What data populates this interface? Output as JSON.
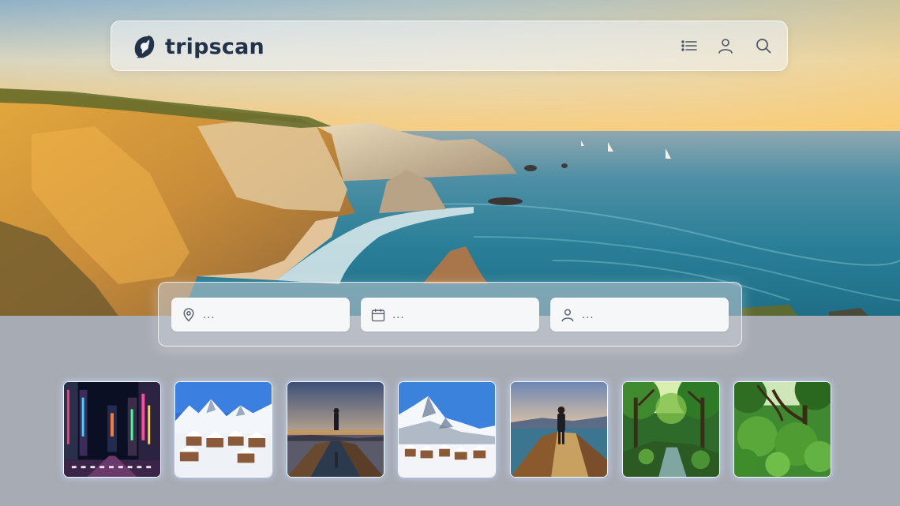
{
  "brand": {
    "name": "tripscan"
  },
  "nav": {
    "icons": [
      "list-icon",
      "user-icon",
      "search-icon"
    ]
  },
  "search": {
    "fields": [
      {
        "icon": "location-pin-icon",
        "value": "..."
      },
      {
        "icon": "calendar-icon",
        "value": "..."
      },
      {
        "icon": "person-icon",
        "value": "..."
      }
    ]
  },
  "destinations": [
    {
      "scene": "neon-city-street"
    },
    {
      "scene": "snowy-mountain-village"
    },
    {
      "scene": "sunset-lake-silhouette"
    },
    {
      "scene": "alpine-snow-village"
    },
    {
      "scene": "cliff-edge-traveler"
    },
    {
      "scene": "jungle-stream"
    },
    {
      "scene": "tropical-rainforest"
    }
  ],
  "colors": {
    "brand_text": "#22324a",
    "panel_bg": "#a7abb3",
    "field_bg": "#f6f7f9"
  }
}
